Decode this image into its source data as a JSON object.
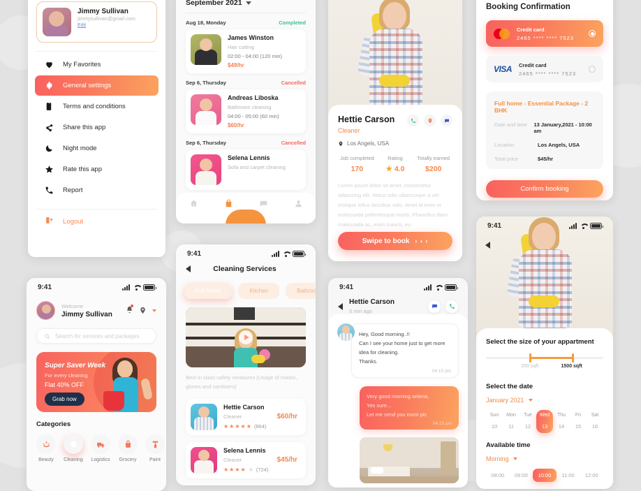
{
  "sidebar": {
    "profile": {
      "name": "Jimmy Sullivan",
      "email": "jimmysullivan@gmail.com",
      "edit": "Edit"
    },
    "items": [
      {
        "label": "My Favorites",
        "icon": "heart-icon",
        "active": false
      },
      {
        "label": "General settings",
        "icon": "gear-icon",
        "active": true
      },
      {
        "label": "Terms and conditions",
        "icon": "document-icon",
        "active": false
      },
      {
        "label": "Share this app",
        "icon": "share-icon",
        "active": false
      },
      {
        "label": "Night mode",
        "icon": "moon-icon",
        "active": false
      },
      {
        "label": "Rate this app",
        "icon": "star-icon",
        "active": false
      },
      {
        "label": "Report",
        "icon": "phone-icon",
        "active": false
      }
    ],
    "logout": {
      "label": "Logout",
      "icon": "logout-icon"
    }
  },
  "schedule": {
    "month": "September 2021",
    "entries": [
      {
        "date": "Aug 18, Monday",
        "status": "Completed",
        "status_type": "completed",
        "name": "James Winston",
        "service": "Hair cutting",
        "time": "02:00  -  04:00 (120 min)",
        "rate": "$49/hr"
      },
      {
        "date": "Sep 6, Thursday",
        "status": "Cancelled",
        "status_type": "cancelled",
        "name": "Andreas Liboska",
        "service": "Bathroom cleaning",
        "time": "04:00 - 05:00 (60 min)",
        "rate": "$60/hr"
      },
      {
        "date": "Sep 6, Thursday",
        "status": "Cancelled",
        "status_type": "cancelled",
        "name": "Selena Lennis",
        "service": "Sofa and carpet cleaning",
        "time": "",
        "rate": ""
      }
    ],
    "nav": [
      "home-icon",
      "bag-icon",
      "chat-icon",
      "profile-icon"
    ]
  },
  "worker_profile": {
    "name": "Hettie Carson",
    "role": "Cleaner",
    "location": "Los Angels, USA",
    "actions": [
      "phone-icon",
      "location-icon",
      "chat-icon"
    ],
    "stats": [
      {
        "label": "Job completed",
        "value": "170"
      },
      {
        "label": "Rating",
        "value": "4.0",
        "star": "★"
      },
      {
        "label": "Totally earned",
        "value": "$200"
      }
    ],
    "description": "Lorem ipsum dolor sit amet, consectetur adipiscing elit. Netus odio ullamcorper a vel tristique tellus faucibus odio. Amet id enim in malesuada pellentesque morbi. Phasellus diam malesuada ac, enim mauris, eu",
    "cta": "Swipe to book",
    "cta_arrows": "› › ›"
  },
  "booking": {
    "title": "Booking Confirmation",
    "methods": [
      {
        "brand": "mastercard",
        "label": "Credit card",
        "number": "2465  ****  ****  7523",
        "selected": true
      },
      {
        "brand": "visa",
        "label": "Credit card",
        "number": "2465  ****  ****  7523",
        "selected": false
      }
    ],
    "summary_title": "Full home - Essential Package - 2 BHK",
    "summary_rows": [
      {
        "key": "Date and time",
        "value": "13 January,2021 - 10:00 am"
      },
      {
        "key": "Location",
        "value": "Los Angels, USA"
      },
      {
        "key": "Total price",
        "value": "$45/hr"
      }
    ],
    "confirm": "Confirm booking"
  },
  "home": {
    "status_time": "9:41",
    "welcome": "Welcome",
    "user": "Jimmy Sullivan",
    "search_placeholder": "Search for services and packages",
    "banner": {
      "title": "Super Saver Week",
      "subtitle": "For every cleaning",
      "offer": "Flat 40% OFF",
      "button": "Grab now"
    },
    "categories_title": "Categories",
    "categories": [
      {
        "label": "Beauty",
        "icon": "lotus-icon",
        "active": false
      },
      {
        "label": "Cleaning",
        "icon": "sponge-icon",
        "active": true
      },
      {
        "label": "Logistics",
        "icon": "truck-icon",
        "active": false
      },
      {
        "label": "Grocery",
        "icon": "basket-icon",
        "active": false
      },
      {
        "label": "Paint",
        "icon": "paint-icon",
        "active": false
      }
    ]
  },
  "services": {
    "status_time": "9:41",
    "title": "Cleaning Services",
    "tabs": [
      {
        "label": "Full Home",
        "active": true
      },
      {
        "label": "Kitchen",
        "active": false
      },
      {
        "label": "Bathroom",
        "active": false
      }
    ],
    "note": "Best in class safety measures (Usage of masks, gloves and sanitisers)",
    "workers": [
      {
        "name": "Hettie Carson",
        "role": "Cleaner",
        "stars": 5,
        "reviews": "(864)",
        "price": "$60/hr"
      },
      {
        "name": "Selena Lennis",
        "role": "Cleaner",
        "stars": 4,
        "reviews": "(724)",
        "price": "$45/hr"
      }
    ]
  },
  "chat": {
    "status_time": "9:41",
    "name": "Hettie Carson",
    "ago": "5 min ago",
    "actions": [
      "chat-icon",
      "phone-icon"
    ],
    "messages": [
      {
        "side": "in",
        "text": "Hey, Good morning..!!\nCan I see your home just to get more idea for cleaning.\nThanks.",
        "time": "04:15 pm"
      },
      {
        "side": "out",
        "text": "Very good morning selena,\nYes sure...\nLet me send you room pic",
        "time": "04:15 pm"
      }
    ]
  },
  "apartment": {
    "status_time": "9:41",
    "size_title": "Select the size of your appartment",
    "size_min": "200 sqft",
    "size_max": "1500 sqft",
    "date_title": "Select the date",
    "month": "January 2021",
    "days": [
      {
        "name": "Sun",
        "num": "10",
        "active": false
      },
      {
        "name": "Mon",
        "num": "11",
        "active": false
      },
      {
        "name": "Tue",
        "num": "12",
        "active": false
      },
      {
        "name": "Wed",
        "num": "13",
        "active": true
      },
      {
        "name": "Thu",
        "num": "14",
        "active": false
      },
      {
        "name": "Fri",
        "num": "15",
        "active": false
      },
      {
        "name": "Sat",
        "num": "16",
        "active": false
      }
    ],
    "time_title": "Available time",
    "period": "Morning",
    "slots": [
      {
        "label": "08:00",
        "active": false
      },
      {
        "label": "09:00",
        "active": false
      },
      {
        "label": "10:00",
        "active": true
      },
      {
        "label": "11:00",
        "active": false
      },
      {
        "label": "12:00",
        "active": false
      }
    ]
  },
  "colors": {
    "accent_start": "#f9615f",
    "accent_end": "#fba45f",
    "orange": "#f5874f",
    "green": "#3fbf8f",
    "red": "#f6665f",
    "background": "#e2e2e2"
  }
}
